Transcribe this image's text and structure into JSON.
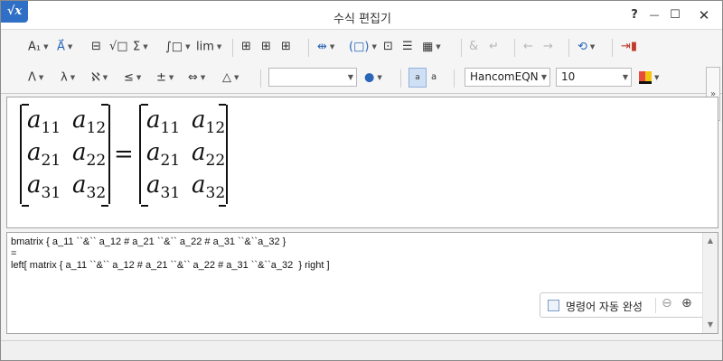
{
  "window": {
    "title": "수식 편집기",
    "logo": "√x",
    "help": "?",
    "minimize": "—",
    "maximize": "☐",
    "close": "✕"
  },
  "toolbar": {
    "row1": [
      {
        "id": "font-style",
        "label": "A₁",
        "dropdown": true
      },
      {
        "id": "vector-accent",
        "label": "A⃗",
        "dropdown": true
      },
      {
        "id": "fraction",
        "label": "⊟"
      },
      {
        "id": "root",
        "label": "√□"
      },
      {
        "id": "sum",
        "label": "Σ",
        "dropdown": true
      },
      {
        "id": "integral",
        "label": "∫□",
        "dropdown": true
      },
      {
        "id": "limit",
        "label": "lim",
        "dropdown": true
      },
      {
        "id": "matrix-1",
        "label": "⊞"
      },
      {
        "id": "matrix-2",
        "label": "⊞"
      },
      {
        "id": "matrix-3",
        "label": "⊞"
      },
      {
        "id": "arrange",
        "label": "⇹",
        "dropdown": true
      },
      {
        "id": "bracket",
        "label": "(□)",
        "dropdown": true
      },
      {
        "id": "array-1",
        "label": "⊡"
      },
      {
        "id": "array-2",
        "label": "☰"
      },
      {
        "id": "array-3",
        "label": "▦",
        "dropdown": true
      },
      {
        "id": "ampersand",
        "label": "&",
        "disabled": true
      },
      {
        "id": "newline",
        "label": "↵",
        "disabled": true
      },
      {
        "id": "prev",
        "label": "←",
        "disabled": true
      },
      {
        "id": "next",
        "label": "→",
        "disabled": true
      },
      {
        "id": "refresh",
        "label": "⟲",
        "dropdown": true
      },
      {
        "id": "insert",
        "label": "⇥▮"
      }
    ],
    "row2": [
      {
        "id": "greek-upper",
        "label": "Λ",
        "dropdown": true
      },
      {
        "id": "greek-lower",
        "label": "λ",
        "dropdown": true
      },
      {
        "id": "symbols",
        "label": "ℵ",
        "dropdown": true
      },
      {
        "id": "relations",
        "label": "≤",
        "dropdown": true
      },
      {
        "id": "operators",
        "label": "±",
        "dropdown": true
      },
      {
        "id": "arrows",
        "label": "⇔",
        "dropdown": true
      },
      {
        "id": "misc",
        "label": "△",
        "dropdown": true
      }
    ],
    "space_combo_value": "",
    "font_combo_value": "HancomEQN",
    "size_combo_value": "10",
    "toggle_a": "a",
    "toggle_b": "a"
  },
  "preview": {
    "left_matrix": [
      [
        "a",
        "11"
      ],
      [
        "a",
        "12"
      ],
      [
        "a",
        "21"
      ],
      [
        "a",
        "22"
      ],
      [
        "a",
        "31"
      ],
      [
        "a",
        "32"
      ]
    ],
    "equals": "=",
    "right_matrix": [
      [
        "a",
        "11"
      ],
      [
        "a",
        "12"
      ],
      [
        "a",
        "21"
      ],
      [
        "a",
        "22"
      ],
      [
        "a",
        "31"
      ],
      [
        "a",
        "32"
      ]
    ]
  },
  "editor": {
    "script": "bmatrix { a_11 ``&`` a_12 # a_21 ``&`` a_22 # a_31 ``&``a_32 }\n=\nleft[ matrix { a_11 ``&`` a_12 # a_21 ``&`` a_22 # a_31 ``&``a_32  } right ]",
    "autocomplete_label": "명령어 자동 완성",
    "autocomplete_checked": false
  }
}
